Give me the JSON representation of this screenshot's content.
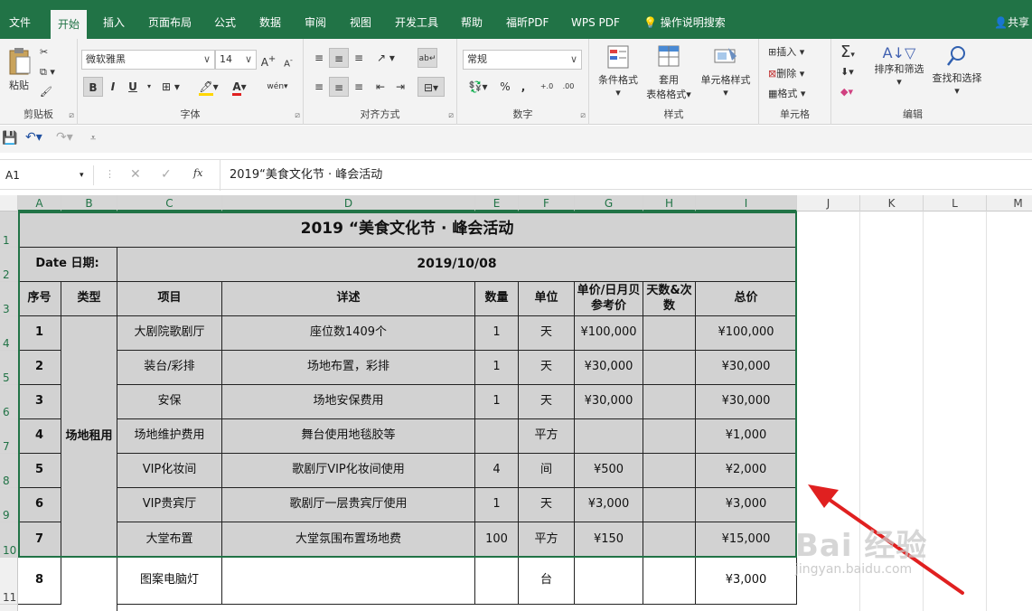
{
  "ribbon_tabs": [
    "文件",
    "开始",
    "插入",
    "页面布局",
    "公式",
    "数据",
    "审阅",
    "视图",
    "开发工具",
    "帮助",
    "福昕PDF",
    "WPS PDF",
    "操作说明搜索"
  ],
  "share_label": "共享",
  "clipboard": {
    "paste": "粘贴",
    "group": "剪贴板"
  },
  "font": {
    "name": "微软雅黑",
    "size": "14",
    "bold": "B",
    "italic": "I",
    "underline": "U",
    "phonetic": "wén",
    "group": "字体"
  },
  "alignment": {
    "group": "对齐方式"
  },
  "number": {
    "format": "常规",
    "percent": "%",
    "comma": ",",
    "group": "数字"
  },
  "styles": {
    "conditional": "条件格式",
    "table_format_line1": "套用",
    "table_format_line2": "表格格式",
    "cell_styles": "单元格样式",
    "group": "样式"
  },
  "cells": {
    "insert": "插入",
    "delete": "删除",
    "format": "格式",
    "group": "单元格"
  },
  "editing": {
    "sort_filter": "排序和筛选",
    "find_select": "查找和选择",
    "group": "编辑"
  },
  "formula_bar": {
    "name_box": "A1",
    "fx": "fx",
    "content": "2019“美食文化节 · 峰会活动"
  },
  "columns": [
    "A",
    "B",
    "C",
    "D",
    "E",
    "F",
    "G",
    "H",
    "I",
    "J",
    "K",
    "L",
    "M"
  ],
  "rows": [
    "1",
    "2",
    "3",
    "4",
    "5",
    "6",
    "7",
    "8",
    "9",
    "10",
    "11"
  ],
  "sheet": {
    "title": "2019 “美食文化节 · 峰会活动",
    "date_label": "Date  日期:",
    "date_value": "2019/10/08",
    "headers": [
      "序号",
      "类型",
      "项目",
      "详述",
      "数量",
      "单位",
      "单价/日月贝参考价",
      "天数&次数",
      "总价"
    ],
    "category": "场地租用",
    "items": [
      {
        "no": "1",
        "item": "大剧院歌剧厅",
        "desc": "座位数1409个",
        "qty": "1",
        "unit": "天",
        "price": "¥100,000",
        "days": "",
        "total": "¥100,000"
      },
      {
        "no": "2",
        "item": "装台/彩排",
        "desc": "场地布置，彩排",
        "qty": "1",
        "unit": "天",
        "price": "¥30,000",
        "days": "",
        "total": "¥30,000"
      },
      {
        "no": "3",
        "item": "安保",
        "desc": "场地安保费用",
        "qty": "1",
        "unit": "天",
        "price": "¥30,000",
        "days": "",
        "total": "¥30,000"
      },
      {
        "no": "4",
        "item": "场地维护费用",
        "desc": "舞台使用地毯胶等",
        "qty": "",
        "unit": "平方",
        "price": "",
        "days": "",
        "total": "¥1,000"
      },
      {
        "no": "5",
        "item": "VIP化妆间",
        "desc": "歌剧厅VIP化妆间使用",
        "qty": "4",
        "unit": "间",
        "price": "¥500",
        "days": "",
        "total": "¥2,000"
      },
      {
        "no": "6",
        "item": "VIP贵宾厅",
        "desc": "歌剧厅一层贵宾厅使用",
        "qty": "1",
        "unit": "天",
        "price": "¥3,000",
        "days": "",
        "total": "¥3,000"
      },
      {
        "no": "7",
        "item": "大堂布置",
        "desc": "大堂氛围布置场地费",
        "qty": "100",
        "unit": "平方",
        "price": "¥150",
        "days": "",
        "total": "¥15,000"
      },
      {
        "no": "8",
        "item": "图案电脑灯",
        "desc": "",
        "qty": "",
        "unit": "台",
        "price": "",
        "days": "",
        "total": "¥3,000"
      }
    ]
  },
  "watermark": {
    "brand": "Bai 经验",
    "url": "jingyan.baidu.com"
  },
  "colors": {
    "accent": "#217346",
    "shade": "#d2d2d2",
    "arrow": "#e02020"
  }
}
